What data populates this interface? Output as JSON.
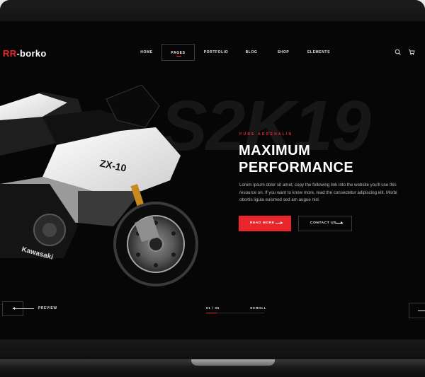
{
  "brand": {
    "prefix": "RR",
    "suffix": "-borko"
  },
  "nav": {
    "items": [
      {
        "label": "HOME"
      },
      {
        "label": "PAGES",
        "active": true
      },
      {
        "label": "PORTFOLIO"
      },
      {
        "label": "BLOG"
      },
      {
        "label": "SHOP"
      },
      {
        "label": "ELEMENTS"
      }
    ],
    "icons": [
      "search-icon",
      "cart-icon"
    ]
  },
  "hero": {
    "background_text": "S2K19",
    "eyebrow": "PURE ADRENALIN",
    "headline_line1": "MAXIMUM",
    "headline_line2": "PERFORMANCE",
    "description": "Lorem ipsum dolor sit amet, copy the following link into the website you'll use this resource on. If you want to know more, read the consectetur adipiscing elit. Morbi obortis ligula euismod sed am augue nisl.",
    "primary_button": "READ MORE",
    "secondary_button": "CONTACT US",
    "image_text": {
      "model": "ZX-10",
      "brand": "Kawasaki"
    }
  },
  "slider": {
    "prev_label": "PREVIEW",
    "counter": "01 / 05",
    "progress": 0.2,
    "scroll_label": "SCROLL"
  },
  "colors": {
    "accent": "#e8262c",
    "background": "#060606",
    "text": "#ffffff"
  }
}
